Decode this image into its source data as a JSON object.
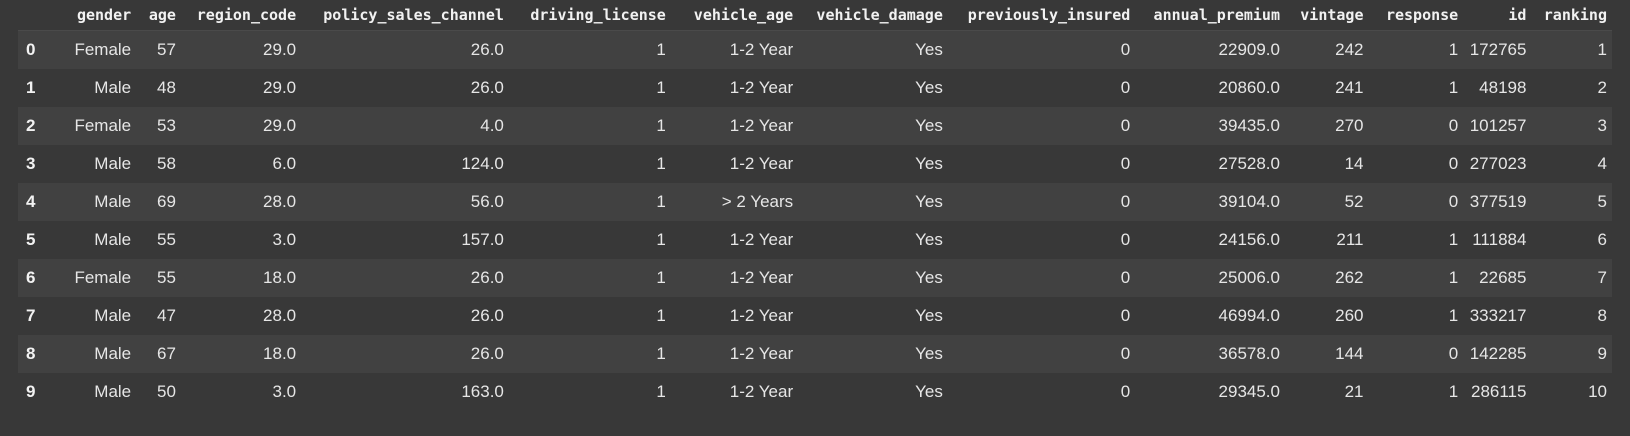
{
  "table": {
    "columns": [
      "gender",
      "age",
      "region_code",
      "policy_sales_channel",
      "driving_license",
      "vehicle_age",
      "vehicle_damage",
      "previously_insured",
      "annual_premium",
      "vintage",
      "response",
      "id",
      "ranking"
    ],
    "rows": [
      {
        "index": "0",
        "cells": [
          "Female",
          "57",
          "29.0",
          "26.0",
          "1",
          "1-2 Year",
          "Yes",
          "0",
          "22909.0",
          "242",
          "1",
          "172765",
          "1"
        ]
      },
      {
        "index": "1",
        "cells": [
          "Male",
          "48",
          "29.0",
          "26.0",
          "1",
          "1-2 Year",
          "Yes",
          "0",
          "20860.0",
          "241",
          "1",
          "48198",
          "2"
        ]
      },
      {
        "index": "2",
        "cells": [
          "Female",
          "53",
          "29.0",
          "4.0",
          "1",
          "1-2 Year",
          "Yes",
          "0",
          "39435.0",
          "270",
          "0",
          "101257",
          "3"
        ]
      },
      {
        "index": "3",
        "cells": [
          "Male",
          "58",
          "6.0",
          "124.0",
          "1",
          "1-2 Year",
          "Yes",
          "0",
          "27528.0",
          "14",
          "0",
          "277023",
          "4"
        ]
      },
      {
        "index": "4",
        "cells": [
          "Male",
          "69",
          "28.0",
          "56.0",
          "1",
          "> 2 Years",
          "Yes",
          "0",
          "39104.0",
          "52",
          "0",
          "377519",
          "5"
        ]
      },
      {
        "index": "5",
        "cells": [
          "Male",
          "55",
          "3.0",
          "157.0",
          "1",
          "1-2 Year",
          "Yes",
          "0",
          "24156.0",
          "211",
          "1",
          "111884",
          "6"
        ]
      },
      {
        "index": "6",
        "cells": [
          "Female",
          "55",
          "18.0",
          "26.0",
          "1",
          "1-2 Year",
          "Yes",
          "0",
          "25006.0",
          "262",
          "1",
          "22685",
          "7"
        ]
      },
      {
        "index": "7",
        "cells": [
          "Male",
          "47",
          "28.0",
          "26.0",
          "1",
          "1-2 Year",
          "Yes",
          "0",
          "46994.0",
          "260",
          "1",
          "333217",
          "8"
        ]
      },
      {
        "index": "8",
        "cells": [
          "Male",
          "67",
          "18.0",
          "26.0",
          "1",
          "1-2 Year",
          "Yes",
          "0",
          "36578.0",
          "144",
          "0",
          "142285",
          "9"
        ]
      },
      {
        "index": "9",
        "cells": [
          "Male",
          "50",
          "3.0",
          "163.0",
          "1",
          "1-2 Year",
          "Yes",
          "0",
          "29345.0",
          "21",
          "1",
          "286115",
          "10"
        ]
      }
    ]
  }
}
